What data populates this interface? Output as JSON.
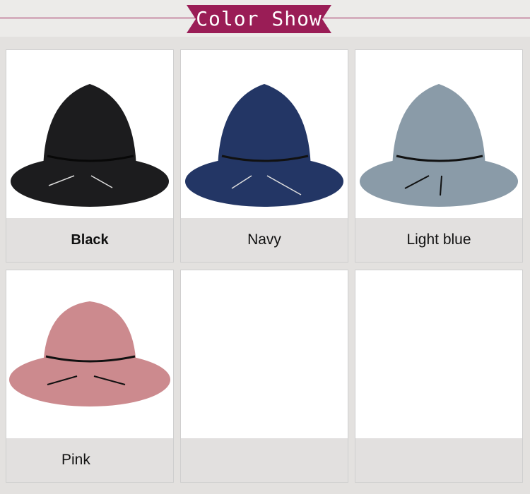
{
  "header": {
    "title": "Color Show"
  },
  "colors": {
    "accent": "#9a1d56"
  },
  "products": [
    {
      "label": "Black",
      "hat_color": "#1c1c1e"
    },
    {
      "label": "Navy",
      "hat_color": "#233665"
    },
    {
      "label": "Light blue",
      "hat_color": "#8a9ba8"
    },
    {
      "label": "Pink",
      "hat_color": "#cc8a8e"
    },
    {
      "label": ""
    },
    {
      "label": ""
    }
  ]
}
